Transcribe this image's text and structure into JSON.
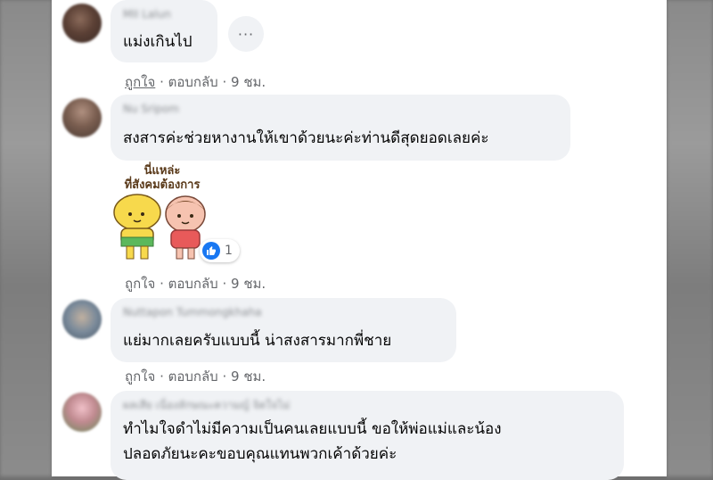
{
  "comments": [
    {
      "name": "MII Lalun",
      "text_lines": [
        "แม่งเกินไป"
      ],
      "actions": {
        "like": "ถูกใจ",
        "reply": "ตอบกลับ",
        "time": "9 ชม."
      }
    },
    {
      "name": "Nu Sripom",
      "text_lines": [
        "สงสารค่ะช่วยหางานให้เขาด้วยนะค่ะท่านดีสุดยอดเลยค่ะ"
      ],
      "sticker_caption": [
        "นี่แหล่ะ",
        "ที่สังคมต้องการ"
      ],
      "reaction_count": "1",
      "actions": {
        "like": "ถูกใจ",
        "reply": "ตอบกลับ",
        "time": "9 ชม."
      }
    },
    {
      "name": "Nuttapon Tummongkhaha",
      "text_lines": [
        "แย่มากเลยครับแบบนี้ น่าสงสารมากพี่ชาย"
      ],
      "actions": {
        "like": "ถูกใจ",
        "reply": "ตอบกลับ",
        "time": "9 ชม."
      }
    },
    {
      "name": "ผลเสีย เนื่องลักษณะความญ์ จิตใจไม่",
      "text_lines": [
        "ทำไมใจดำไม่มีความเป็นคนเลยแบบนี้ ขอให้พ่อแม่และน้อง",
        "ปลอดภัยนะคะขอบคุณแทนพวกเค้าด้วยค่ะ"
      ]
    }
  ],
  "more_button_label": "···",
  "colors": {
    "bubble": "#f0f2f5",
    "text": "#050505",
    "meta": "#65676b",
    "like_blue": "#1877f2"
  },
  "icons": [
    "more-icon",
    "like-reaction-icon"
  ]
}
